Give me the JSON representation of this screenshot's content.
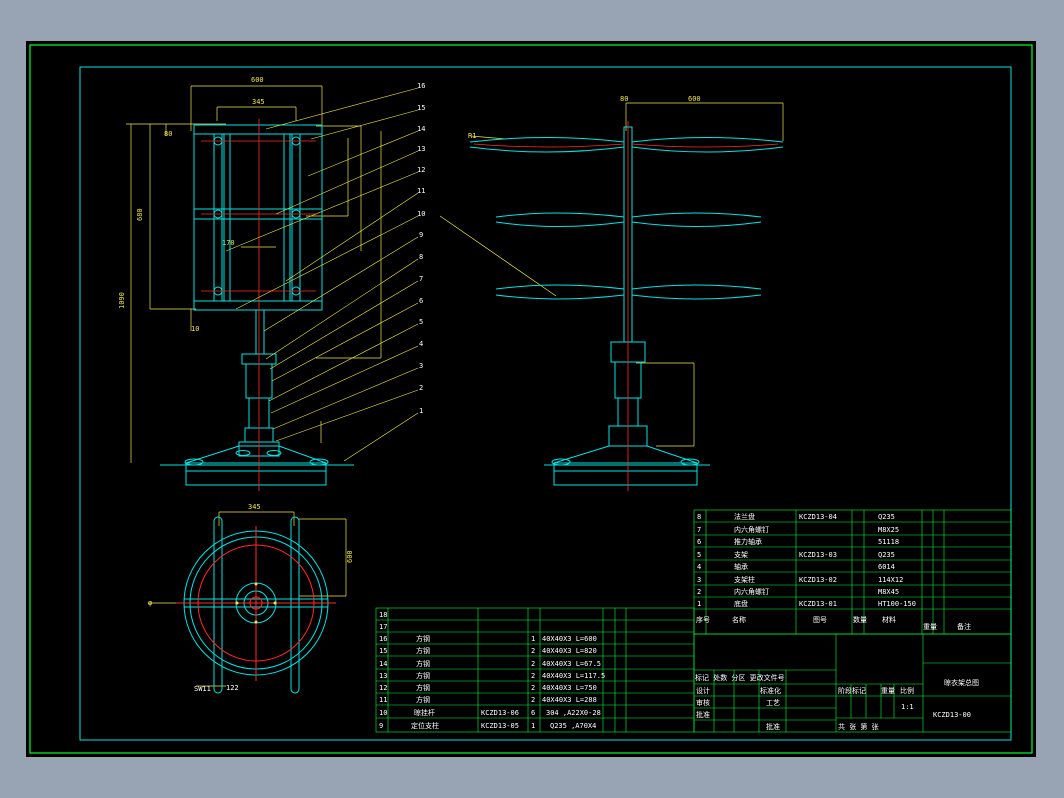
{
  "front_view": {
    "dims": {
      "top_width": "600",
      "inner_width": "345",
      "d1": "80",
      "d2": "170",
      "height_main": "680",
      "height_total": "1090",
      "bottom_d": "10"
    },
    "callouts": [
      "16",
      "15",
      "14",
      "13",
      "12",
      "11",
      "10",
      "9",
      "8",
      "7",
      "6",
      "5",
      "4",
      "3",
      "2",
      "1"
    ]
  },
  "side_view": {
    "dims": {
      "width": "600",
      "top": "80",
      "r": "R1"
    }
  },
  "plan_view": {
    "dims": {
      "width": "345",
      "side": "600",
      "left": "φ",
      "label": "SW11",
      "angle": "122"
    }
  },
  "bom_upper": {
    "rows": [
      {
        "no": "8",
        "name": "法兰盘",
        "code": "KCZD13-04",
        "material": "Q235"
      },
      {
        "no": "7",
        "name": "内六角螺钉",
        "code": "",
        "material": "M8X25"
      },
      {
        "no": "6",
        "name": "推力轴承",
        "code": "",
        "material": "51118"
      },
      {
        "no": "5",
        "name": "支架",
        "code": "KCZD13-03",
        "material": "Q235"
      },
      {
        "no": "4",
        "name": "轴承",
        "code": "",
        "material": "6014"
      },
      {
        "no": "3",
        "name": "支架柱",
        "code": "KCZD13-02",
        "material": "114X12"
      },
      {
        "no": "2",
        "name": "内六角螺钉",
        "code": "",
        "material": "M8X45"
      },
      {
        "no": "1",
        "name": "底盘",
        "code": "KCZD13-01",
        "material": "HT100-150"
      }
    ],
    "header": {
      "no": "序号",
      "name": "名称",
      "code": "图号",
      "qty": "数量",
      "material": "材料",
      "weight": "重量",
      "remark": "备注"
    }
  },
  "bom_lower": {
    "rows": [
      {
        "no": "18",
        "name": "",
        "code": "",
        "qty": "",
        "spec": ""
      },
      {
        "no": "17",
        "name": "",
        "code": "",
        "qty": "",
        "spec": ""
      },
      {
        "no": "16",
        "name": "方钢",
        "code": "",
        "qty": "1",
        "spec": "40X40X3 L=600"
      },
      {
        "no": "15",
        "name": "方钢",
        "code": "",
        "qty": "2",
        "spec": "40X40X3 L=820"
      },
      {
        "no": "14",
        "name": "方钢",
        "code": "",
        "qty": "2",
        "spec": "40X40X3 L=67.5"
      },
      {
        "no": "13",
        "name": "方钢",
        "code": "",
        "qty": "2",
        "spec": "40X40X3 L=117.5"
      },
      {
        "no": "12",
        "name": "方钢",
        "code": "",
        "qty": "2",
        "spec": "40X40X3 L=750"
      },
      {
        "no": "11",
        "name": "方钢",
        "code": "",
        "qty": "2",
        "spec": "40X40X3 L=288"
      },
      {
        "no": "10",
        "name": "晾挂杆",
        "code": "KCZD13-06",
        "qty": "6",
        "spec": "304 ,A22X0-28"
      },
      {
        "no": "9",
        "name": "定位支柱",
        "code": "KCZD13-05",
        "qty": "1",
        "spec": "Q235 ,A70X4"
      }
    ]
  },
  "title_block": {
    "drawing_name": "晾衣架总图",
    "drawing_no": "KCZD13-00",
    "scale": "1:1",
    "labels": {
      "revision": "标记 处数 分区 更改文件号",
      "design": "设计",
      "standardize": "标准化",
      "check": "审核",
      "process": "工艺",
      "approve": "批准",
      "stage": "阶段标记",
      "weight": "重量",
      "ratio": "比例",
      "sheets": "共 张 第 张"
    }
  },
  "colors": {
    "frame": "#00ff33",
    "outline": "#00e4e4",
    "center": "#ff2a2a",
    "dim": "#f2e64a",
    "text": "#ffffff",
    "sheet": "#000000",
    "surround": "#98a4b4"
  }
}
